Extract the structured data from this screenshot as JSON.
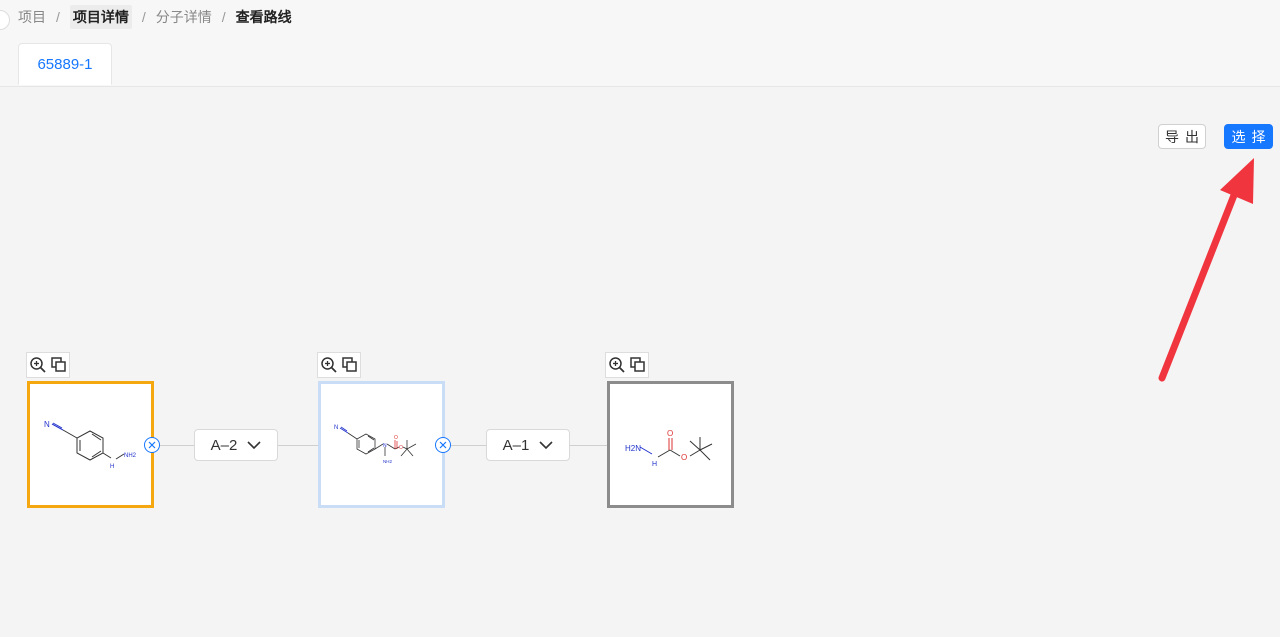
{
  "breadcrumb": {
    "items": [
      "项目",
      "项目详情",
      "分子详情",
      "查看路线"
    ],
    "separator": "/"
  },
  "tab": {
    "label": "65889-1"
  },
  "toolbar": {
    "export_label": "导出",
    "select_label": "选择"
  },
  "route_nodes": [
    {
      "id": "node-1",
      "border_color": "#f5a70f",
      "atom_labels": [
        "N",
        "NH2",
        "H"
      ]
    },
    {
      "id": "node-2",
      "border_color": "#c9ddf6",
      "atom_labels": [
        "N",
        "N",
        "NH2",
        "O",
        "O"
      ]
    },
    {
      "id": "node-3",
      "border_color": "#8c8c8c",
      "atom_labels": [
        "H2N",
        "H",
        "O",
        "O"
      ]
    }
  ],
  "route_selectors": [
    {
      "label": "A–2"
    },
    {
      "label": "A–1"
    }
  ],
  "colors": {
    "accent": "#1677ff",
    "annotation_arrow": "#f0353e"
  },
  "icons": [
    "zoom-in-icon",
    "copy-icon",
    "chevron-down-icon",
    "expand-icon"
  ]
}
